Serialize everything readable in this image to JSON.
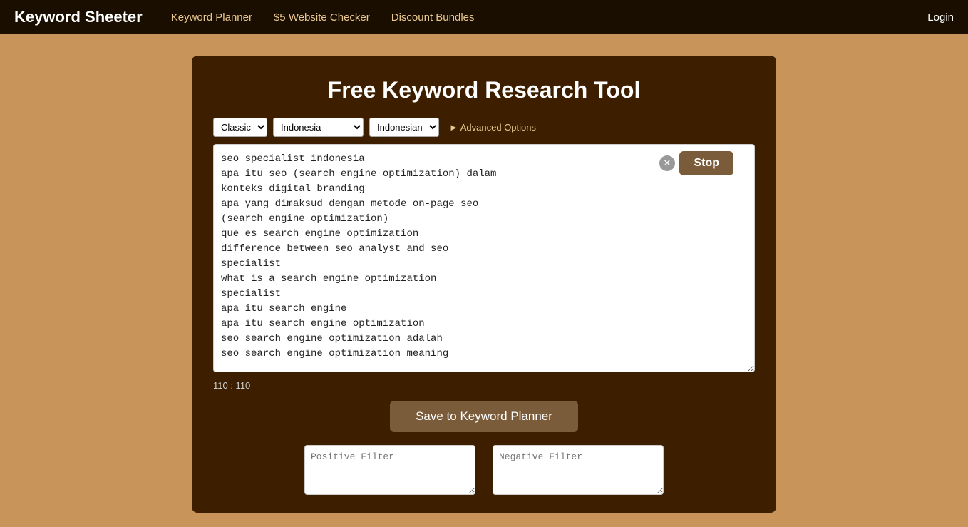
{
  "nav": {
    "brand": "Keyword Sheeter",
    "links": [
      {
        "label": "Keyword Planner"
      },
      {
        "label": "$5 Website Checker"
      },
      {
        "label": "Discount Bundles"
      }
    ],
    "login": "Login"
  },
  "page": {
    "title": "Free Keyword Research Tool"
  },
  "controls": {
    "mode_options": [
      "Classic"
    ],
    "mode_selected": "Classic",
    "country_selected": "Indonesia",
    "language_selected": "Indonesian",
    "advanced_label": "► Advanced Options"
  },
  "textarea": {
    "content": "seo specialist indonesia\napa itu seo (search engine optimization) dalam\nkonteks digital branding\napa yang dimaksud dengan metode on-page seo\n(search engine optimization)\nque es search engine optimization\ndifference between seo analyst and seo\nspecialist\nwhat is a search engine optimization\nspecialist\napa itu search engine\napa itu search engine optimization\nseo search engine optimization adalah\nseo search engine optimization meaning"
  },
  "stop_button": {
    "label": "Stop"
  },
  "counter": {
    "value": "110 : 110"
  },
  "save_button": {
    "label": "Save to Keyword Planner"
  },
  "positive_filter": {
    "placeholder": "Positive Filter"
  },
  "negative_filter": {
    "placeholder": "Negative Filter"
  }
}
